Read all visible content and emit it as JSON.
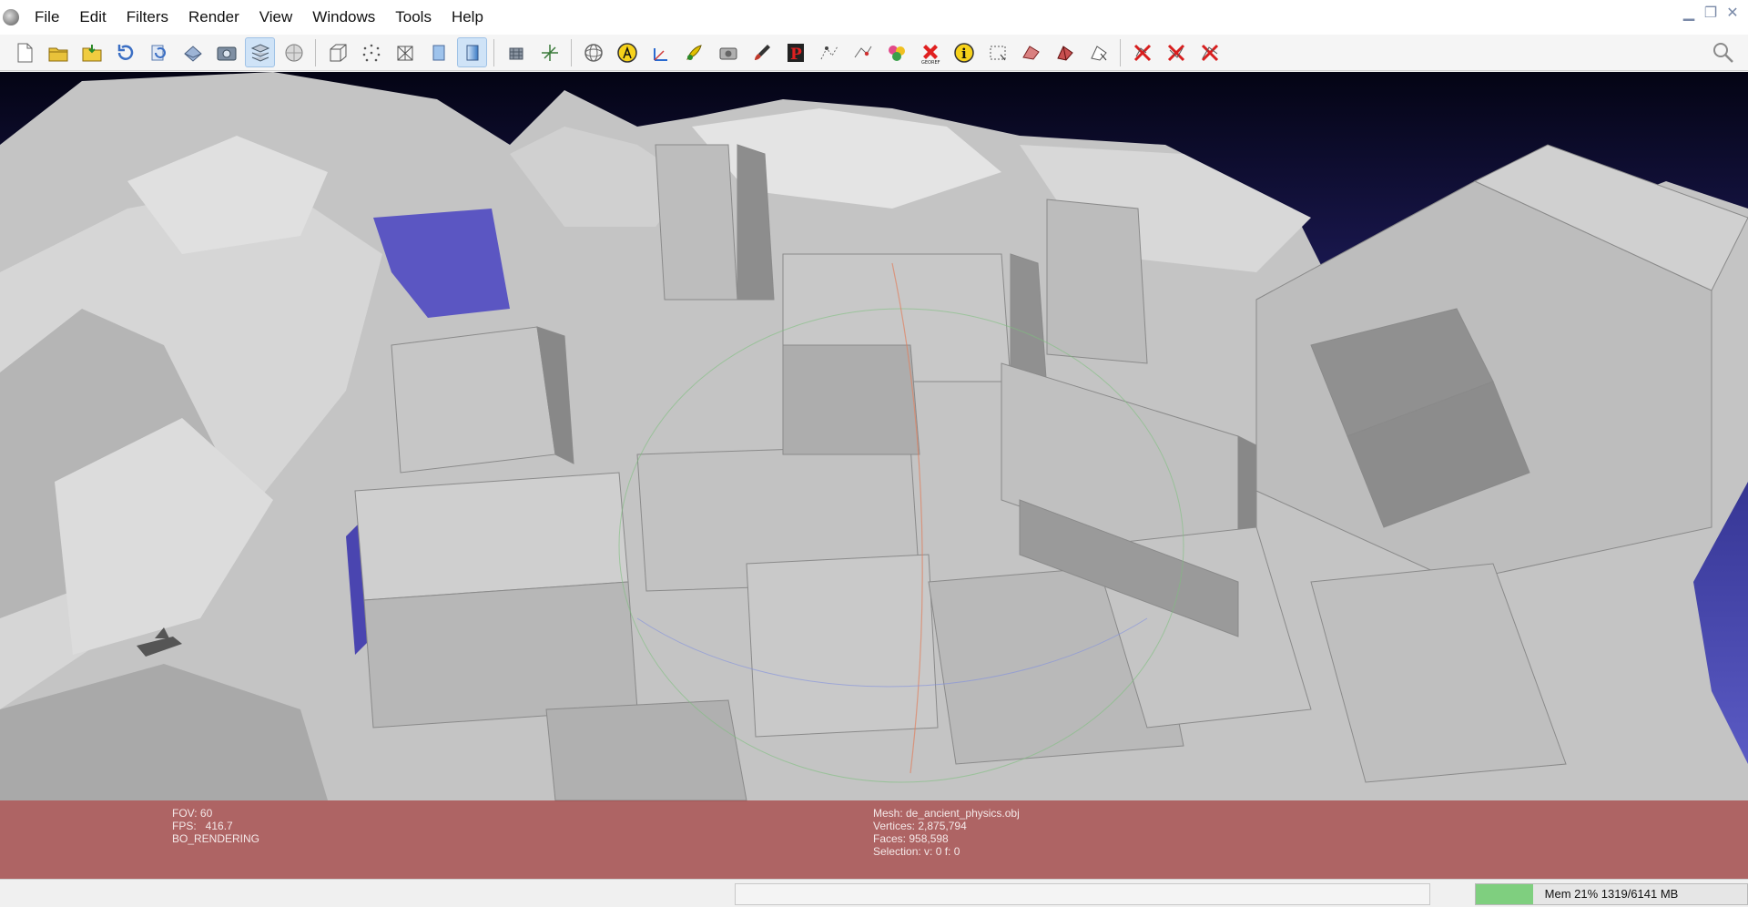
{
  "menu": {
    "items": [
      "File",
      "Edit",
      "Filters",
      "Render",
      "View",
      "Windows",
      "Tools",
      "Help"
    ]
  },
  "window_controls": {
    "minimize": "▁",
    "restore": "❐",
    "close": "✕"
  },
  "toolbar": {
    "icons": [
      "new-project-icon",
      "open-project-icon",
      "import-mesh-icon",
      "reload-icon",
      "reload-all-icon",
      "export-mesh-icon",
      "snapshot-icon",
      "layer-panel-icon",
      "decorator-icon",
      "bounding-box-icon",
      "points-icon",
      "wireframe-icon",
      "flat-shading-icon",
      "smooth-shading-icon",
      "lights-icon",
      "axis-icon",
      "trackball-icon",
      "align-icon",
      "measure-icon",
      "paint-icon",
      "camera-icon",
      "brush-icon",
      "pick-points-icon",
      "selection-icon",
      "edit-vertex-icon",
      "color-paint-icon",
      "georef-icon",
      "info-icon",
      "select-faces-icon",
      "select-vertices-icon",
      "select-connected-icon",
      "select-conn-icon",
      "delete-faces-icon",
      "delete-vertices-icon",
      "delete-selected-icon"
    ]
  },
  "viewport": {
    "info_left": [
      "FOV: 60",
      "FPS:   416.7",
      "BO_RENDERING"
    ],
    "info_center": [
      "Mesh: de_ancient_physics.obj",
      "Vertices: 2,875,794",
      "Faces: 958,598",
      "Selection: v: 0 f: 0"
    ]
  },
  "status": {
    "memory_text": "Mem 21% 1319/6141 MB",
    "memory_fraction": 0.21
  },
  "colors": {
    "info_panel": "#a02828",
    "memory_fill": "#7fcf7f",
    "mesh": "#b8b8b8"
  }
}
